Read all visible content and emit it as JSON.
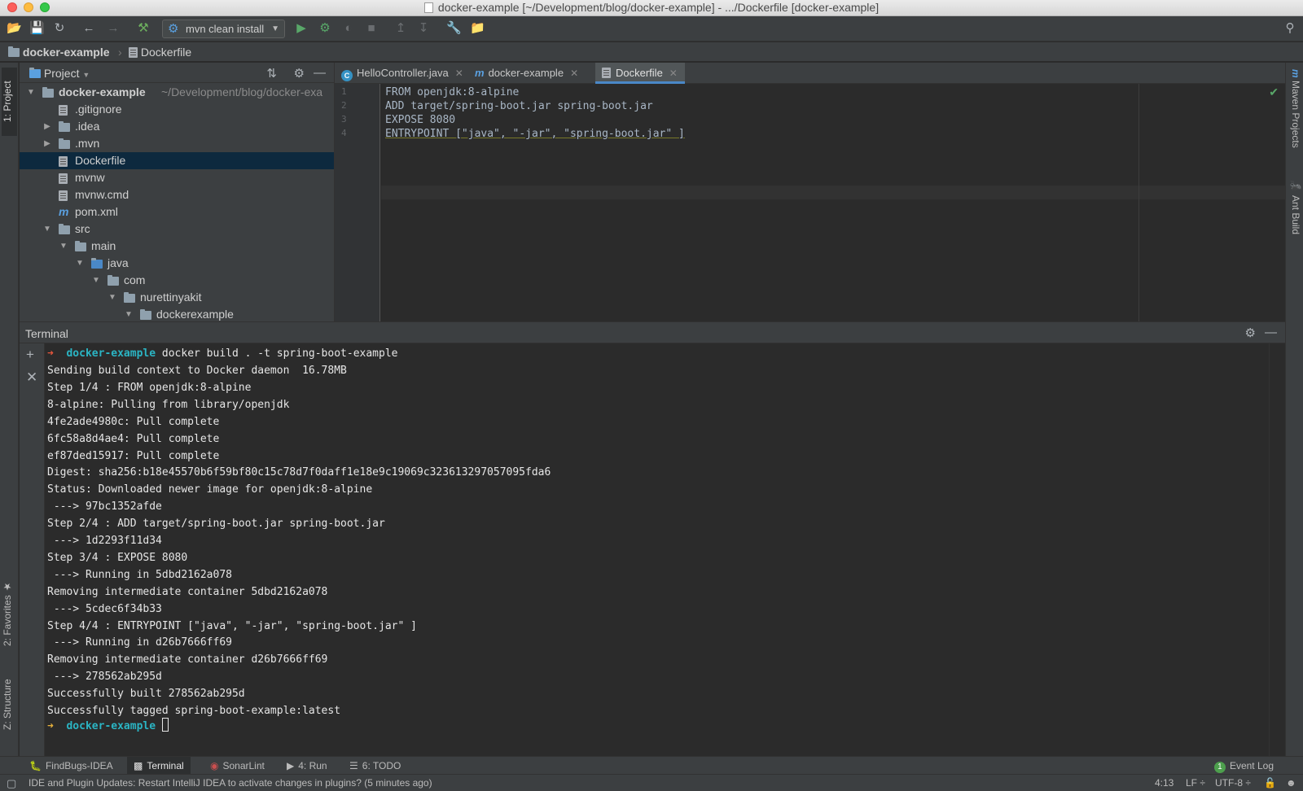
{
  "window": {
    "title": "docker-example [~/Development/blog/docker-example] - .../Dockerfile [docker-example]"
  },
  "toolbar": {
    "run_config": "mvn clean install"
  },
  "breadcrumb": {
    "project": "docker-example",
    "file": "Dockerfile"
  },
  "left_stripe": {
    "project_tab": "1: Project",
    "favorites_tab": "2: Favorites",
    "structure_tab": "Z: Structure"
  },
  "right_stripe": {
    "maven_tab": "Maven Projects",
    "ant_tab": "Ant Build"
  },
  "project_panel": {
    "title": "Project",
    "tree": [
      {
        "label": "docker-example",
        "hint": "~/Development/blog/docker-exa",
        "depth": 0,
        "expanded": true,
        "kind": "module"
      },
      {
        "label": ".gitignore",
        "depth": 1,
        "kind": "file"
      },
      {
        "label": ".idea",
        "depth": 1,
        "expanded": false,
        "kind": "folder"
      },
      {
        "label": ".mvn",
        "depth": 1,
        "expanded": false,
        "kind": "folder"
      },
      {
        "label": "Dockerfile",
        "depth": 1,
        "kind": "file",
        "selected": true
      },
      {
        "label": "mvnw",
        "depth": 1,
        "kind": "file"
      },
      {
        "label": "mvnw.cmd",
        "depth": 1,
        "kind": "file"
      },
      {
        "label": "pom.xml",
        "depth": 1,
        "kind": "maven"
      },
      {
        "label": "src",
        "depth": 1,
        "expanded": true,
        "kind": "folder"
      },
      {
        "label": "main",
        "depth": 2,
        "expanded": true,
        "kind": "folder"
      },
      {
        "label": "java",
        "depth": 3,
        "expanded": true,
        "kind": "source-folder"
      },
      {
        "label": "com",
        "depth": 4,
        "expanded": true,
        "kind": "package"
      },
      {
        "label": "nurettinyakit",
        "depth": 5,
        "expanded": true,
        "kind": "package"
      },
      {
        "label": "dockerexample",
        "depth": 6,
        "expanded": true,
        "kind": "package"
      }
    ]
  },
  "editor": {
    "tabs": [
      {
        "label": "HelloController.java",
        "icon": "class-icon"
      },
      {
        "label": "docker-example",
        "icon": "maven-icon"
      },
      {
        "label": "Dockerfile",
        "icon": "file-icon",
        "active": true
      }
    ],
    "line_numbers": [
      "1",
      "2",
      "3",
      "4"
    ],
    "lines": [
      "FROM openjdk:8-alpine",
      "ADD target/spring-boot.jar spring-boot.jar",
      "EXPOSE 8080",
      "ENTRYPOINT [\"java\", \"-jar\", \"spring-boot.jar\" ]"
    ]
  },
  "terminal": {
    "title": "Terminal",
    "prompt_arrow": "➜",
    "prompt_dir": "docker-example",
    "command": " docker build . -t spring-boot-example",
    "output": [
      "Sending build context to Docker daemon  16.78MB",
      "Step 1/4 : FROM openjdk:8-alpine",
      "8-alpine: Pulling from library/openjdk",
      "4fe2ade4980c: Pull complete",
      "6fc58a8d4ae4: Pull complete",
      "ef87ded15917: Pull complete",
      "Digest: sha256:b18e45570b6f59bf80c15c78d7f0daff1e18e9c19069c323613297057095fda6",
      "Status: Downloaded newer image for openjdk:8-alpine",
      " ---> 97bc1352afde",
      "Step 2/4 : ADD target/spring-boot.jar spring-boot.jar",
      " ---> 1d2293f11d34",
      "Step 3/4 : EXPOSE 8080",
      " ---> Running in 5dbd2162a078",
      "Removing intermediate container 5dbd2162a078",
      " ---> 5cdec6f34b33",
      "Step 4/4 : ENTRYPOINT [\"java\", \"-jar\", \"spring-boot.jar\" ]",
      " ---> Running in d26b7666ff69",
      "Removing intermediate container d26b7666ff69",
      " ---> 278562ab295d",
      "Successfully built 278562ab295d",
      "Successfully tagged spring-boot-example:latest"
    ]
  },
  "bottom_bar": {
    "items": [
      {
        "label": "FindBugs-IDEA",
        "icon": "bug-icon"
      },
      {
        "label": "Terminal",
        "icon": "terminal-icon",
        "active": true
      },
      {
        "label": "SonarLint",
        "icon": "sonarlint-icon"
      },
      {
        "label": "4: Run",
        "icon": "run-icon"
      },
      {
        "label": "6: TODO",
        "icon": "todo-icon"
      }
    ],
    "event_log_count": "1",
    "event_log": "Event Log"
  },
  "status_bar": {
    "message": "IDE and Plugin Updates: Restart IntelliJ IDEA to activate changes in plugins? (5 minutes ago)",
    "position": "4:13",
    "line_sep": "LF ÷",
    "encoding": "UTF-8 ÷"
  },
  "colors": {
    "background": "#2b2b2b",
    "panel": "#3c3f41",
    "selection": "#0d293e",
    "prompt_dir": "#2bb5c4",
    "prompt_arrow": "#e8563c",
    "run_green": "#59a869",
    "accent_blue": "#4a88c7"
  }
}
